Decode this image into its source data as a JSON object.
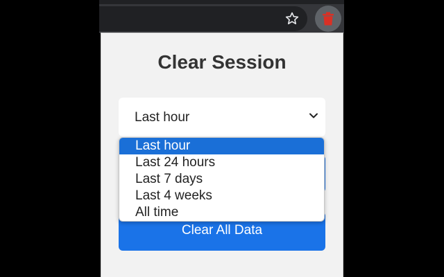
{
  "popup": {
    "title": "Clear Session",
    "select": {
      "selected": "Last hour",
      "options": [
        "Last hour",
        "Last 24 hours",
        "Last 7 days",
        "Last 4 weeks",
        "All time"
      ]
    },
    "clear_button_label": "Clear All Data"
  },
  "toolbar": {
    "bookmark_icon": "star-icon",
    "extension_icon": "trash-icon"
  },
  "colors": {
    "accent": "#1a73e8",
    "trash_icon": "#d93025",
    "popup_background": "#f2f2f2"
  }
}
